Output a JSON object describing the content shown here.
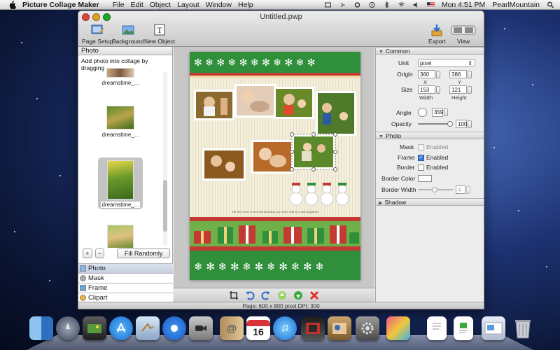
{
  "menubar": {
    "app_name": "Picture Collage Maker",
    "menus": [
      "File",
      "Edit",
      "Object",
      "Layout",
      "Window",
      "Help"
    ],
    "clock": "Mon 4:51 PM",
    "user": "PearlMountain"
  },
  "window": {
    "title": "Untitled.pwp",
    "toolbar": {
      "page_setup": "Page Setup",
      "background": "Background",
      "new_object": "New Object",
      "export": "Export",
      "view": "View"
    }
  },
  "left_panel": {
    "header": "Photo",
    "hint": "Add photo into collage by dragging",
    "thumbnails": [
      {
        "caption": "dreamstime_..."
      },
      {
        "caption": "dreamstime_..."
      },
      {
        "caption": "dreamstime_..."
      },
      {
        "caption": ""
      }
    ],
    "add_label": "+",
    "remove_label": "−",
    "fill_randomly": "Fill Randomly",
    "tabs": [
      "Photo",
      "Mask",
      "Frame",
      "Clipart"
    ]
  },
  "canvas": {
    "greeting": "The New year is here and knocking your door with love and happiness"
  },
  "status": "Page: 600 x 800 pixel DPI: 300",
  "common": {
    "header": "Common",
    "unit_label": "Unit",
    "unit_value": "pixel",
    "origin_label": "Origin",
    "origin_x": "360",
    "origin_y": "386",
    "x_label": "X",
    "y_label": "Y",
    "size_label": "Size",
    "width_value": "153",
    "height_value": "121",
    "width_label": "Width",
    "height_label": "Height",
    "angle_label": "Angle",
    "angle_value": "359",
    "opacity_label": "Opacity",
    "opacity_value": "100"
  },
  "photo": {
    "header": "Photo",
    "mask_label": "Mask",
    "mask_enabled": "Enabled",
    "frame_label": "Frame",
    "frame_enabled": "Enabled",
    "border_label": "Border",
    "border_enabled": "Enabled",
    "border_color_label": "Border Color",
    "border_width_label": "Border Width",
    "border_width_value": "4"
  },
  "shadow": {
    "header": "Shadow"
  },
  "colors": {
    "accent": "#3c78d8",
    "green_band": "#2f8f3a",
    "red_band": "#c23a32"
  },
  "dock": {
    "icons": [
      "finder-icon",
      "launchpad-icon",
      "photo-app-icon",
      "app-store-icon",
      "mail-icon",
      "safari-icon",
      "facetime-icon",
      "address-book-icon",
      "ical-icon",
      "itunes-icon",
      "film-icon",
      "photo-booth-icon",
      "system-preferences-icon",
      "collage-maker-icon",
      "document-icon",
      "document-icon",
      "preview-icon",
      "trash-icon"
    ],
    "ical_day": "16"
  }
}
